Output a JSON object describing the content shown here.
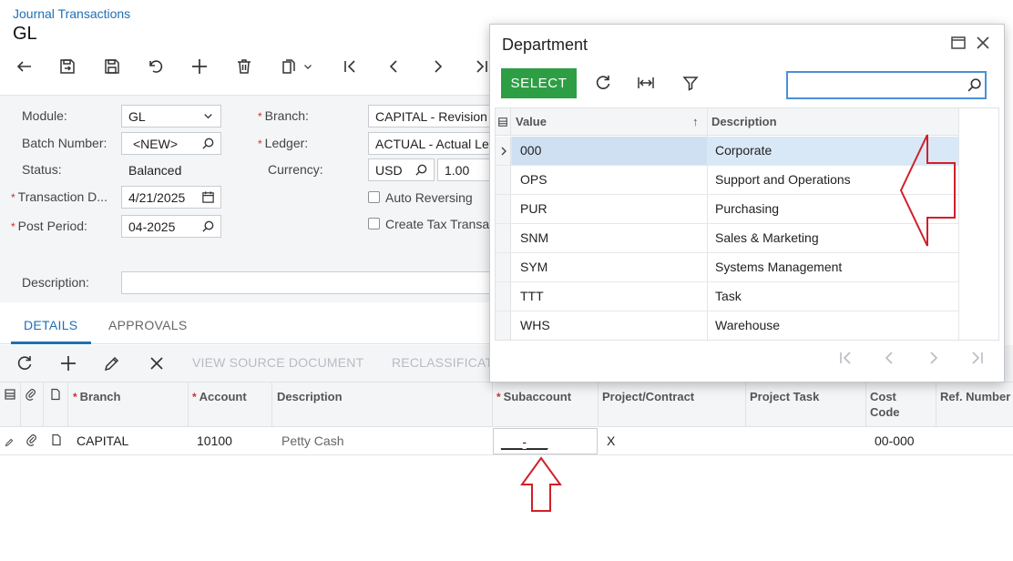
{
  "header": {
    "breadcrumb": "Journal Transactions",
    "screen_id": "GL"
  },
  "toolbar": {
    "icons": [
      "back-icon",
      "save-and-close-icon",
      "save-icon",
      "undo-icon",
      "add-icon",
      "delete-icon",
      "copy-paste-icon",
      "chevron-down-icon",
      "first-record-icon",
      "previous-record-icon",
      "next-record-icon",
      "last-record-icon"
    ]
  },
  "form": {
    "module_label": "Module:",
    "module_value": "GL",
    "batch_label": "Batch Number:",
    "batch_value": "<NEW>",
    "status_label": "Status:",
    "status_value": "Balanced",
    "transaction_date_label": "Transaction D...",
    "transaction_date_value": "4/21/2025",
    "post_period_label": "Post Period:",
    "post_period_value": "04-2025",
    "branch_label": "Branch:",
    "branch_value": "CAPITAL - Revision",
    "ledger_label": "Ledger:",
    "ledger_value": "ACTUAL - Actual Le",
    "currency_label": "Currency:",
    "currency_value": "USD",
    "currency_rate": "1.00",
    "auto_reversing_label": "Auto Reversing",
    "create_tax_label": "Create Tax Transa",
    "description_label": "Description:",
    "description_value": ""
  },
  "tabs": [
    {
      "label": "DETAILS",
      "active": true
    },
    {
      "label": "APPROVALS",
      "active": false
    }
  ],
  "grid_toolbar": {
    "view_source": "VIEW SOURCE DOCUMENT",
    "reclassify": "RECLASSIFICAT"
  },
  "grid": {
    "columns": {
      "branch": "Branch",
      "account": "Account",
      "description": "Description",
      "subaccount": "Subaccount",
      "project": "Project/Contract",
      "task": "Project Task",
      "cost_code_1": "Cost",
      "cost_code_2": "Code",
      "ref": "Ref. Number"
    },
    "row": {
      "branch": "CAPITAL",
      "account": "10100",
      "description": "Petty Cash",
      "subaccount": "___-___",
      "project": "X",
      "cost_code": "00-000"
    }
  },
  "dialog": {
    "title": "Department",
    "select_label": "SELECT",
    "search_value": "",
    "columns": {
      "value": "Value",
      "description": "Description"
    },
    "rows": [
      {
        "value": "000",
        "description": "Corporate",
        "selected": true
      },
      {
        "value": "OPS",
        "description": "Support and Operations",
        "selected": false
      },
      {
        "value": "PUR",
        "description": "Purchasing",
        "selected": false
      },
      {
        "value": "SNM",
        "description": "Sales & Marketing",
        "selected": false
      },
      {
        "value": "SYM",
        "description": "Systems Management",
        "selected": false
      },
      {
        "value": "TTT",
        "description": "Task",
        "selected": false
      },
      {
        "value": "WHS",
        "description": "Warehouse",
        "selected": false
      }
    ]
  },
  "colors": {
    "accent": "#1f6fb5",
    "select_button": "#2e9e45",
    "annotation_arrow": "#d0202a",
    "selected_row": "#d9e8f6"
  }
}
